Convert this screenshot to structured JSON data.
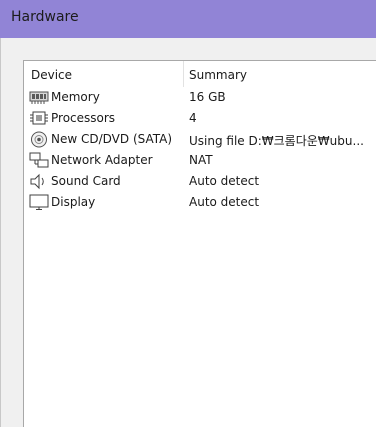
{
  "window": {
    "title": "Hardware"
  },
  "table": {
    "columns": {
      "device": "Device",
      "summary": "Summary"
    },
    "rows": [
      {
        "device": "Memory",
        "summary": "16 GB",
        "icon": "memory-icon"
      },
      {
        "device": "Processors",
        "summary": "4",
        "icon": "processor-icon"
      },
      {
        "device": "New CD/DVD (SATA)",
        "summary": "Using file D:₩크롬다운₩ubu...",
        "icon": "cd-dvd-icon"
      },
      {
        "device": "Network Adapter",
        "summary": "NAT",
        "icon": "network-adapter-icon"
      },
      {
        "device": "Sound Card",
        "summary": "Auto detect",
        "icon": "sound-card-icon"
      },
      {
        "device": "Display",
        "summary": "Auto detect",
        "icon": "display-icon"
      }
    ]
  },
  "colors": {
    "titlebar": "#9184d6",
    "panel": "#f0f0f0",
    "list_background": "#ffffff"
  }
}
